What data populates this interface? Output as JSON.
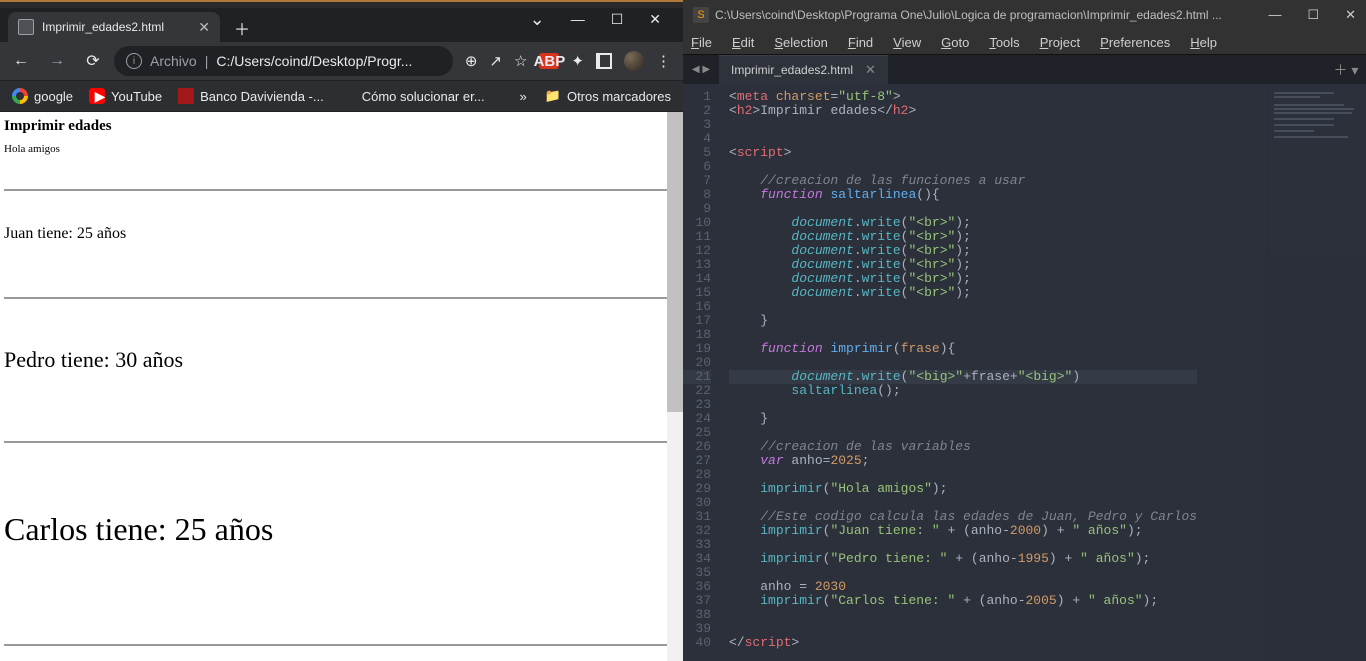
{
  "chrome": {
    "tab_title": "Imprimir_edades2.html",
    "wincontrols": {
      "chev": "⌄",
      "min": "—",
      "max": "☐",
      "close": "✕"
    },
    "nav": {
      "back": "←",
      "forward": "→",
      "reload": "⟳"
    },
    "omnibox": {
      "label": "Archivo",
      "separator": "|",
      "path": "C:/Users/coind/Desktop/Progr..."
    },
    "tools": {
      "zoom": "⊕",
      "share": "↗",
      "star": "☆",
      "abp": "ABP",
      "puzzle": "✦",
      "menu": "⋮"
    },
    "bookmarks": [
      {
        "ico": "g",
        "label": "google"
      },
      {
        "ico": "yt",
        "label": "YouTube"
      },
      {
        "ico": "dv",
        "label": "Banco Davivienda -..."
      },
      {
        "ico": "ms",
        "label": "Cómo solucionar er..."
      }
    ],
    "bookmark_overflow": "»",
    "other_bookmarks": "Otros marcadores"
  },
  "page": {
    "h2": "Imprimir edades",
    "hola": "Hola amigos",
    "line1": "Juan tiene: 25 años",
    "line2": "Pedro tiene: 30 años",
    "line3": "Carlos tiene: 25 años"
  },
  "sublime": {
    "title": "C:\\Users\\coind\\Desktop\\Programa One\\Julio\\Logica de programacion\\Imprimir_edades2.html ...",
    "wincontrols": {
      "min": "—",
      "max": "☐",
      "close": "✕"
    },
    "menu": [
      "File",
      "Edit",
      "Selection",
      "Find",
      "View",
      "Goto",
      "Tools",
      "Project",
      "Preferences",
      "Help"
    ],
    "filetab": "Imprimir_edades2.html",
    "active_line": 21,
    "code": [
      {
        "n": 1,
        "t": [
          [
            "pun",
            "<"
          ],
          [
            "tag",
            "meta "
          ],
          [
            "attr",
            "charset"
          ],
          [
            "pun",
            "="
          ],
          [
            "str",
            "\"utf-8\""
          ],
          [
            "pun",
            ">"
          ]
        ]
      },
      {
        "n": 2,
        "t": [
          [
            "pun",
            "<"
          ],
          [
            "tag",
            "h2"
          ],
          [
            "pun",
            ">"
          ],
          [
            "pun",
            "Imprimir edades"
          ],
          [
            "pun",
            "</"
          ],
          [
            "tag",
            "h2"
          ],
          [
            "pun",
            ">"
          ]
        ]
      },
      {
        "n": 3,
        "t": [
          [
            "pun",
            ""
          ]
        ]
      },
      {
        "n": 4,
        "t": [
          [
            "pun",
            ""
          ]
        ]
      },
      {
        "n": 5,
        "t": [
          [
            "pun",
            "<"
          ],
          [
            "tag",
            "script"
          ],
          [
            "pun",
            ">"
          ]
        ]
      },
      {
        "n": 6,
        "t": [
          [
            "pun",
            ""
          ]
        ]
      },
      {
        "n": 7,
        "t": [
          [
            "pun",
            "    "
          ],
          [
            "cmt",
            "//creacion de las funciones a usar"
          ]
        ]
      },
      {
        "n": 8,
        "t": [
          [
            "pun",
            "    "
          ],
          [
            "kw",
            "function"
          ],
          [
            "pun",
            " "
          ],
          [
            "fn",
            "saltarlinea"
          ],
          [
            "pun",
            "(){"
          ]
        ]
      },
      {
        "n": 9,
        "t": [
          [
            "pun",
            ""
          ]
        ]
      },
      {
        "n": 10,
        "t": [
          [
            "pun",
            "        "
          ],
          [
            "var",
            "document"
          ],
          [
            "pun",
            "."
          ],
          [
            "call",
            "write"
          ],
          [
            "pun",
            "("
          ],
          [
            "lit",
            "\"<br>\""
          ],
          [
            "pun",
            ");"
          ]
        ]
      },
      {
        "n": 11,
        "t": [
          [
            "pun",
            "        "
          ],
          [
            "var",
            "document"
          ],
          [
            "pun",
            "."
          ],
          [
            "call",
            "write"
          ],
          [
            "pun",
            "("
          ],
          [
            "lit",
            "\"<br>\""
          ],
          [
            "pun",
            ");"
          ]
        ]
      },
      {
        "n": 12,
        "t": [
          [
            "pun",
            "        "
          ],
          [
            "var",
            "document"
          ],
          [
            "pun",
            "."
          ],
          [
            "call",
            "write"
          ],
          [
            "pun",
            "("
          ],
          [
            "lit",
            "\"<br>\""
          ],
          [
            "pun",
            ");"
          ]
        ]
      },
      {
        "n": 13,
        "t": [
          [
            "pun",
            "        "
          ],
          [
            "var",
            "document"
          ],
          [
            "pun",
            "."
          ],
          [
            "call",
            "write"
          ],
          [
            "pun",
            "("
          ],
          [
            "lit",
            "\"<hr>\""
          ],
          [
            "pun",
            ");"
          ]
        ]
      },
      {
        "n": 14,
        "t": [
          [
            "pun",
            "        "
          ],
          [
            "var",
            "document"
          ],
          [
            "pun",
            "."
          ],
          [
            "call",
            "write"
          ],
          [
            "pun",
            "("
          ],
          [
            "lit",
            "\"<br>\""
          ],
          [
            "pun",
            ");"
          ]
        ]
      },
      {
        "n": 15,
        "t": [
          [
            "pun",
            "        "
          ],
          [
            "var",
            "document"
          ],
          [
            "pun",
            "."
          ],
          [
            "call",
            "write"
          ],
          [
            "pun",
            "("
          ],
          [
            "lit",
            "\"<br>\""
          ],
          [
            "pun",
            ");"
          ]
        ]
      },
      {
        "n": 16,
        "t": [
          [
            "pun",
            ""
          ]
        ]
      },
      {
        "n": 17,
        "t": [
          [
            "pun",
            "    }"
          ]
        ]
      },
      {
        "n": 18,
        "t": [
          [
            "pun",
            ""
          ]
        ]
      },
      {
        "n": 19,
        "t": [
          [
            "pun",
            "    "
          ],
          [
            "kw",
            "function"
          ],
          [
            "pun",
            " "
          ],
          [
            "fn",
            "imprimir"
          ],
          [
            "pun",
            "("
          ],
          [
            "p",
            "frase"
          ],
          [
            "pun",
            "){"
          ]
        ]
      },
      {
        "n": 20,
        "t": [
          [
            "pun",
            ""
          ]
        ]
      },
      {
        "n": 21,
        "t": [
          [
            "pun",
            "        "
          ],
          [
            "var",
            "document"
          ],
          [
            "pun",
            "."
          ],
          [
            "call",
            "write"
          ],
          [
            "pun",
            "("
          ],
          [
            "lit",
            "\"<big>\""
          ],
          [
            "pun",
            "+"
          ],
          [
            "pun",
            "frase+"
          ],
          [
            "lit",
            "\"<big>\""
          ],
          [
            "pun",
            ")"
          ]
        ]
      },
      {
        "n": 22,
        "t": [
          [
            "pun",
            "        "
          ],
          [
            "call",
            "saltarlinea"
          ],
          [
            "pun",
            "();"
          ]
        ]
      },
      {
        "n": 23,
        "t": [
          [
            "pun",
            ""
          ]
        ]
      },
      {
        "n": 24,
        "t": [
          [
            "pun",
            "    }"
          ]
        ]
      },
      {
        "n": 25,
        "t": [
          [
            "pun",
            ""
          ]
        ]
      },
      {
        "n": 26,
        "t": [
          [
            "pun",
            "    "
          ],
          [
            "cmt",
            "//creacion de las variables"
          ]
        ]
      },
      {
        "n": 27,
        "t": [
          [
            "pun",
            "    "
          ],
          [
            "kw",
            "var"
          ],
          [
            "pun",
            " anho="
          ],
          [
            "num",
            "2025"
          ],
          [
            "pun",
            ";"
          ]
        ]
      },
      {
        "n": 28,
        "t": [
          [
            "pun",
            ""
          ]
        ]
      },
      {
        "n": 29,
        "t": [
          [
            "pun",
            "    "
          ],
          [
            "call",
            "imprimir"
          ],
          [
            "pun",
            "("
          ],
          [
            "lit",
            "\"Hola amigos\""
          ],
          [
            "pun",
            ");"
          ]
        ]
      },
      {
        "n": 30,
        "t": [
          [
            "pun",
            ""
          ]
        ]
      },
      {
        "n": 31,
        "t": [
          [
            "pun",
            "    "
          ],
          [
            "cmt",
            "//Este codigo calcula las edades de Juan, Pedro y Carlos"
          ]
        ]
      },
      {
        "n": 32,
        "t": [
          [
            "pun",
            "    "
          ],
          [
            "call",
            "imprimir"
          ],
          [
            "pun",
            "("
          ],
          [
            "lit",
            "\"Juan tiene: \""
          ],
          [
            "pun",
            " + (anho-"
          ],
          [
            "num",
            "2000"
          ],
          [
            "pun",
            ") + "
          ],
          [
            "lit",
            "\" años\""
          ],
          [
            "pun",
            ");"
          ]
        ]
      },
      {
        "n": 33,
        "t": [
          [
            "pun",
            ""
          ]
        ]
      },
      {
        "n": 34,
        "t": [
          [
            "pun",
            "    "
          ],
          [
            "call",
            "imprimir"
          ],
          [
            "pun",
            "("
          ],
          [
            "lit",
            "\"Pedro tiene: \""
          ],
          [
            "pun",
            " + (anho-"
          ],
          [
            "num",
            "1995"
          ],
          [
            "pun",
            ") + "
          ],
          [
            "lit",
            "\" años\""
          ],
          [
            "pun",
            ");"
          ]
        ]
      },
      {
        "n": 35,
        "t": [
          [
            "pun",
            ""
          ]
        ]
      },
      {
        "n": 36,
        "t": [
          [
            "pun",
            "    anho = "
          ],
          [
            "num",
            "2030"
          ]
        ]
      },
      {
        "n": 37,
        "t": [
          [
            "pun",
            "    "
          ],
          [
            "call",
            "imprimir"
          ],
          [
            "pun",
            "("
          ],
          [
            "lit",
            "\"Carlos tiene: \""
          ],
          [
            "pun",
            " + (anho-"
          ],
          [
            "num",
            "2005"
          ],
          [
            "pun",
            ") + "
          ],
          [
            "lit",
            "\" años\""
          ],
          [
            "pun",
            ");"
          ]
        ]
      },
      {
        "n": 38,
        "t": [
          [
            "pun",
            ""
          ]
        ]
      },
      {
        "n": 39,
        "t": [
          [
            "pun",
            ""
          ]
        ]
      },
      {
        "n": 40,
        "t": [
          [
            "pun",
            "</"
          ],
          [
            "tag",
            "script"
          ],
          [
            "pun",
            ">"
          ]
        ]
      }
    ]
  }
}
